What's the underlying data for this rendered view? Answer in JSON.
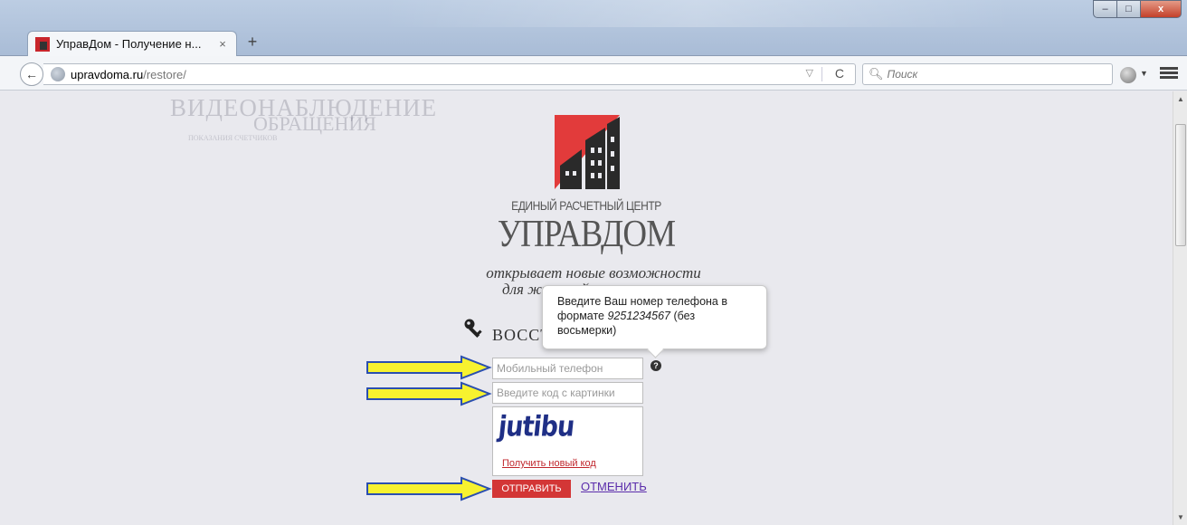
{
  "browser": {
    "tab": {
      "title": "УправДом - Получение н...",
      "close": "×"
    },
    "new_tab": "+",
    "window": {
      "minimize": "–",
      "maximize": "□",
      "close": "x"
    },
    "address": {
      "host": "upravdoma.ru",
      "path": "/restore/",
      "dropdown": "▽",
      "reload": "C"
    },
    "search": {
      "placeholder": "Поиск",
      "icon": "search-icon"
    }
  },
  "page": {
    "background_text": {
      "line1": "ВИДЕОНАБЛЮДЕНИЕ",
      "line2": "ОБРАЩЕНИЯ",
      "line3": "ПОКАЗАНИЯ СЧЕТЧИКОВ"
    },
    "brand": {
      "subtitle": "ЕДИНЫЙ РАСЧЕТНЫЙ ЦЕНТР",
      "name": "УПРАВДОМ"
    },
    "slogan": {
      "line1": "открывает новые возможности",
      "line2": "для жителей многоэтажек"
    },
    "heading": "ВОССТАНОВЛЕНИЕ ПАРОЛЯ",
    "tooltip": {
      "before": "Введите Ваш номер телефона в формате ",
      "example": "9251234567",
      "after": " (без восьмерки)"
    },
    "form": {
      "phone_placeholder": "Мобильный телефон",
      "code_placeholder": "Введите код с картинки",
      "help": "?",
      "captcha_text": "jutibu",
      "captcha_refresh": "Получить новый код",
      "submit": "ОТПРАВИТЬ",
      "cancel": "ОТМЕНИТЬ"
    }
  },
  "colors": {
    "accent": "#d33636",
    "link": "#5b2dab",
    "arrow_fill": "#f7f22f",
    "arrow_stroke": "#2b4fb0"
  }
}
